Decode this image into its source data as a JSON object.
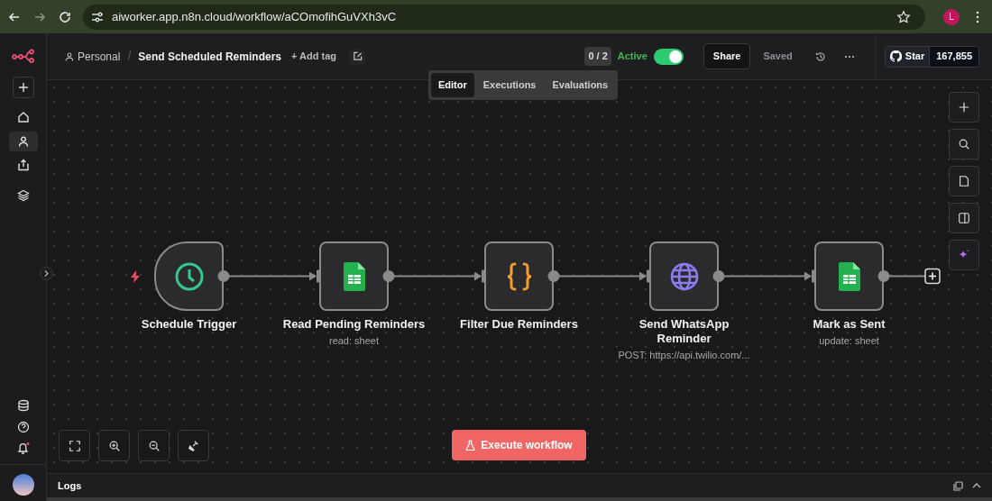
{
  "browser": {
    "url": "aiworker.app.n8n.cloud/workflow/aCOmofihGuVXh3vC",
    "profile_initial": "L"
  },
  "header": {
    "project": "Personal",
    "separator": "/",
    "workflow_name": "Send Scheduled Reminders",
    "add_tag": "+ Add tag",
    "counter": "0 / 2",
    "active": {
      "label": "Active",
      "on": true
    },
    "share": "Share",
    "saved": "Saved",
    "github": {
      "label": "Star",
      "count": "167,855"
    }
  },
  "tabs": [
    {
      "label": "Editor",
      "selected": true
    },
    {
      "label": "Executions",
      "selected": false
    },
    {
      "label": "Evaluations",
      "selected": false
    }
  ],
  "nodes": [
    {
      "kind": "trigger",
      "title": "Schedule Trigger"
    },
    {
      "kind": "sheet",
      "title": "Read Pending Reminders",
      "subtitle": "read: sheet"
    },
    {
      "kind": "code",
      "title": "Filter Due Reminders"
    },
    {
      "kind": "http",
      "title": "Send WhatsApp Reminder",
      "subtitle": "POST: https://api.twilio.com/..."
    },
    {
      "kind": "sheet",
      "title": "Mark as Sent",
      "subtitle": "update: sheet"
    }
  ],
  "execute_button": "Execute workflow",
  "logs": {
    "title": "Logs"
  }
}
